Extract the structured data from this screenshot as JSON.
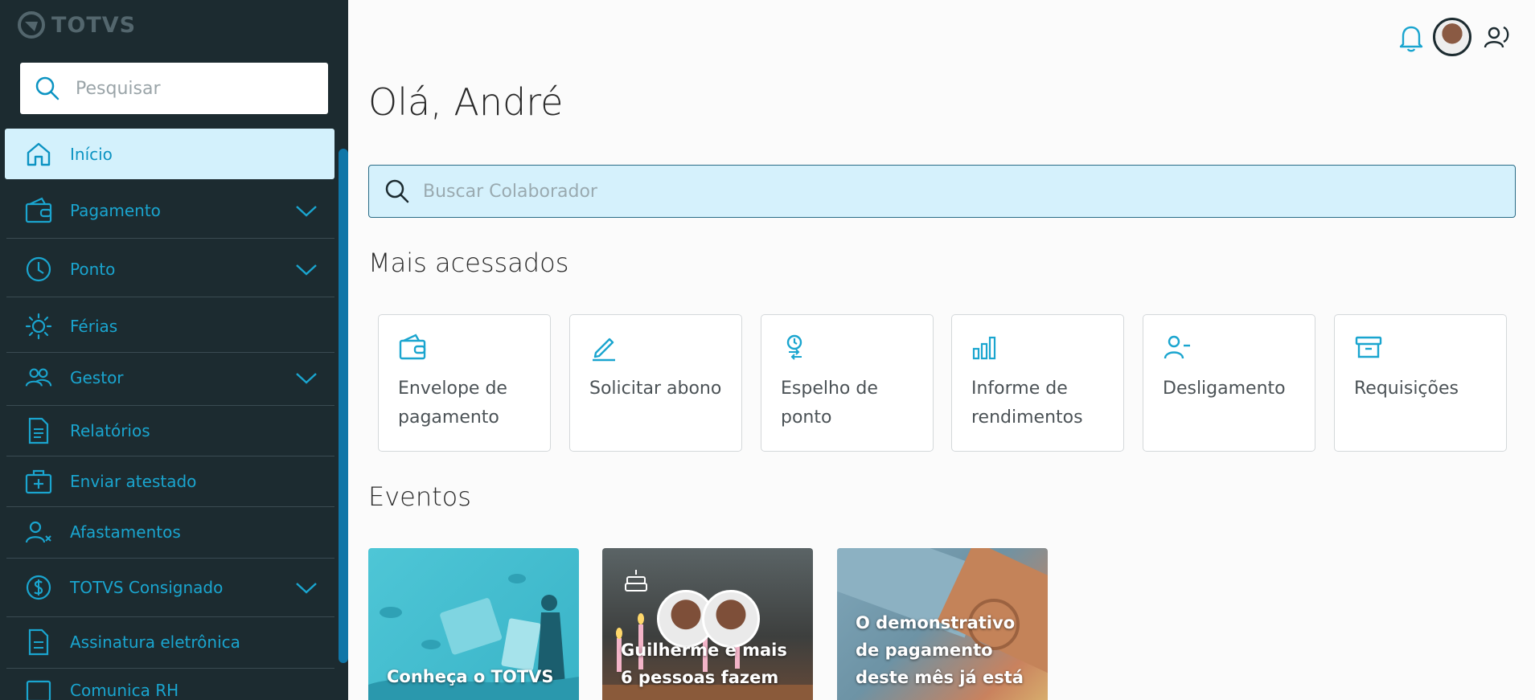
{
  "brand": {
    "logo_text": "TOTVS"
  },
  "sidebar": {
    "search_placeholder": "Pesquisar",
    "items": [
      {
        "label": "Início",
        "icon": "home-icon",
        "active": true,
        "expandable": false
      },
      {
        "label": "Pagamento",
        "icon": "wallet-icon",
        "active": false,
        "expandable": true
      },
      {
        "label": "Ponto",
        "icon": "clock-icon",
        "active": false,
        "expandable": true
      },
      {
        "label": "Férias",
        "icon": "sun-icon",
        "active": false,
        "expandable": false
      },
      {
        "label": "Gestor",
        "icon": "people-icon",
        "active": false,
        "expandable": true
      },
      {
        "label": "Relatórios",
        "icon": "document-icon",
        "active": false,
        "expandable": false
      },
      {
        "label": "Enviar atestado",
        "icon": "medical-kit-icon",
        "active": false,
        "expandable": false
      },
      {
        "label": "Afastamentos",
        "icon": "user-x-icon",
        "active": false,
        "expandable": false
      },
      {
        "label": "TOTVS Consignado",
        "icon": "dollar-circle-icon",
        "active": false,
        "expandable": true
      },
      {
        "label": "Assinatura eletrônica",
        "icon": "signature-doc-icon",
        "active": false,
        "expandable": false
      },
      {
        "label": "Comunica RH",
        "icon": "message-icon",
        "active": false,
        "expandable": false
      }
    ]
  },
  "main": {
    "greeting": "Olá, André",
    "colab_search_placeholder": "Buscar Colaborador",
    "most_accessed_title": "Mais acessados",
    "most_accessed": [
      {
        "label": "Envelope de pagamento",
        "icon": "wallet-icon"
      },
      {
        "label": "Solicitar abono",
        "icon": "pencil-icon"
      },
      {
        "label": "Espelho de ponto",
        "icon": "clock-transfer-icon"
      },
      {
        "label": "Informe de rendimentos",
        "icon": "bar-chart-icon"
      },
      {
        "label": "Desligamento",
        "icon": "user-minus-icon"
      },
      {
        "label": "Requisições",
        "icon": "archive-box-icon"
      }
    ],
    "events_title": "Eventos",
    "events": [
      {
        "text": "Conheça o TOTVS",
        "theme": "teal-illustration"
      },
      {
        "text": "Guilherme e mais 6 pessoas fazem",
        "theme": "birthday"
      },
      {
        "text": "O demonstrativo de pagamento deste mês já está",
        "theme": "money"
      }
    ]
  },
  "colors": {
    "sidebar_bg": "#1c2b30",
    "accent": "#1aa5cf",
    "active_bg": "#d3f1fc",
    "search_bg": "#d5f1fc"
  }
}
